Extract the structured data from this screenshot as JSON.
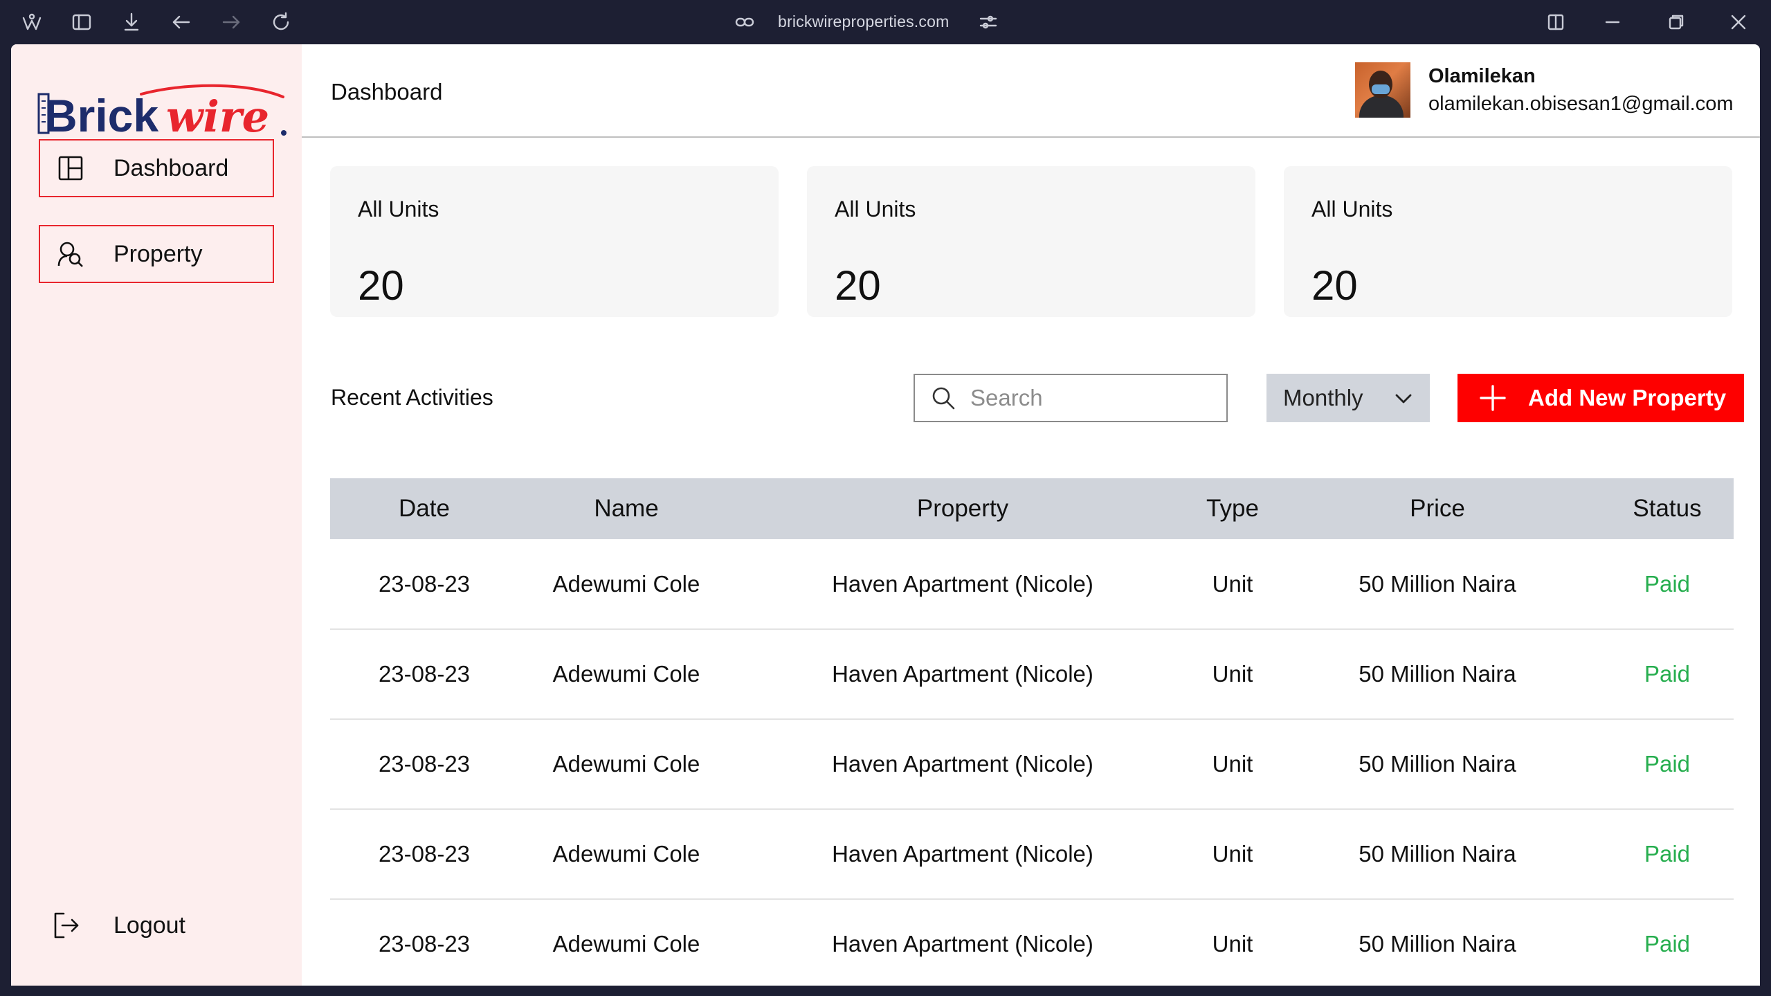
{
  "browser": {
    "url": "brickwireproperties.com"
  },
  "brand": {
    "name_part1": "Brick",
    "name_part2": "wire",
    "colors": {
      "primary": "#1d2c6b",
      "accent": "#e8252d"
    }
  },
  "sidebar": {
    "items": [
      {
        "label": "Dashboard",
        "icon": "layout-icon"
      },
      {
        "label": "Property",
        "icon": "user-search-icon"
      }
    ],
    "logout_label": "Logout"
  },
  "header": {
    "title": "Dashboard",
    "user": {
      "name": "Olamilekan",
      "email": "olamilekan.obisesan1@gmail.com"
    }
  },
  "stats": [
    {
      "label": "All Units",
      "value": "20"
    },
    {
      "label": "All Units",
      "value": "20"
    },
    {
      "label": "All Units",
      "value": "20"
    }
  ],
  "activities": {
    "title": "Recent Activities",
    "search_placeholder": "Search",
    "period": "Monthly",
    "add_label": "Add New Property",
    "columns": [
      "Date",
      "Name",
      "Property",
      "Type",
      "Price",
      "Status"
    ],
    "rows": [
      [
        "23-08-23",
        "Adewumi Cole",
        "Haven Apartment (Nicole)",
        "Unit",
        "50 Million Naira",
        "Paid"
      ],
      [
        "23-08-23",
        "Adewumi Cole",
        "Haven Apartment (Nicole)",
        "Unit",
        "50 Million Naira",
        "Paid"
      ],
      [
        "23-08-23",
        "Adewumi Cole",
        "Haven Apartment (Nicole)",
        "Unit",
        "50 Million Naira",
        "Paid"
      ],
      [
        "23-08-23",
        "Adewumi Cole",
        "Haven Apartment (Nicole)",
        "Unit",
        "50 Million Naira",
        "Paid"
      ],
      [
        "23-08-23",
        "Adewumi Cole",
        "Haven Apartment (Nicole)",
        "Unit",
        "50 Million Naira",
        "Paid"
      ]
    ],
    "status_color": "#27ae4f"
  }
}
